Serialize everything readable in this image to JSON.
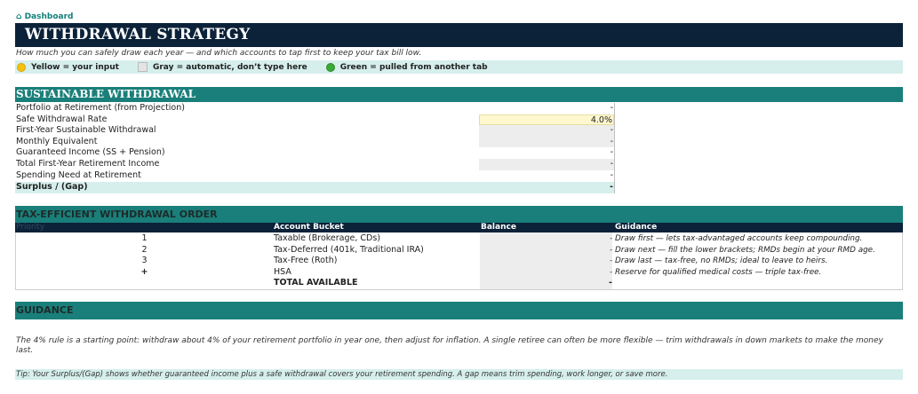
{
  "nav": {
    "dashboard_label": "⌂ Dashboard"
  },
  "header": {
    "title": "WITHDRAWAL STRATEGY",
    "subtitle": "How much you can safely draw each year — and which accounts to tap first to keep your tax bill low."
  },
  "legend": {
    "yellow": "Yellow = your input",
    "gray": "Gray = automatic, don’t type here",
    "green": "Green = pulled from another tab",
    "colors": {
      "yellow": "#f4c20d",
      "gray": "#e4e4e4",
      "green": "#3aa935"
    }
  },
  "sustainable": {
    "title": "SUSTAINABLE WITHDRAWAL",
    "rows": [
      {
        "label": "Portfolio at Retirement (from Projection)",
        "value": "-"
      },
      {
        "label": "Safe Withdrawal Rate",
        "value": "4.0%"
      },
      {
        "label": "First-Year Sustainable Withdrawal",
        "value": "-"
      },
      {
        "label": "Monthly Equivalent",
        "value": "-"
      },
      {
        "label": "Guaranteed Income (SS + Pension)",
        "value": "-"
      },
      {
        "label": "Total First-Year Retirement Income",
        "value": "-"
      },
      {
        "label": "Spending Need at Retirement",
        "value": "-"
      },
      {
        "label": "Surplus / (Gap)",
        "value": "-"
      }
    ]
  },
  "order": {
    "title": "TAX-EFFICIENT WITHDRAWAL ORDER",
    "headers": {
      "priority": "Priority",
      "account": "Account Bucket",
      "balance": "Balance",
      "guidance": "Guidance"
    },
    "rows": [
      {
        "priority": "1",
        "account": "Taxable (Brokerage, CDs)",
        "balance": "-",
        "guidance": "Draw first — lets tax-advantaged accounts keep compounding."
      },
      {
        "priority": "2",
        "account": "Tax-Deferred (401k, Traditional IRA)",
        "balance": "-",
        "guidance": "Draw next — fill the lower brackets; RMDs begin at your RMD age."
      },
      {
        "priority": "3",
        "account": "Tax-Free (Roth)",
        "balance": "-",
        "guidance": "Draw last — tax-free, no RMDs; ideal to leave to heirs."
      },
      {
        "priority": "+",
        "account": "HSA",
        "balance": "-",
        "guidance": "Reserve for qualified medical costs — triple tax-free."
      }
    ],
    "total": {
      "label": "TOTAL AVAILABLE",
      "balance": "-"
    }
  },
  "guidance": {
    "title": "GUIDANCE",
    "text": "The 4% rule is a starting point: withdraw about 4% of your retirement portfolio in year one, then adjust for inflation. A single retiree can often be more flexible — trim withdrawals in down markets to make the money last.",
    "tip": "Tip: Your Surplus/(Gap) shows whether guaranteed income plus a safe withdrawal covers your retirement spending. A gap means trim spending, work longer, or save more."
  },
  "colors": {
    "navy": "#0b2239",
    "teal": "#1a7f7a",
    "mint": "#d6efec",
    "input_yellow": "#fff8cf",
    "auto_gray": "#ededed"
  }
}
